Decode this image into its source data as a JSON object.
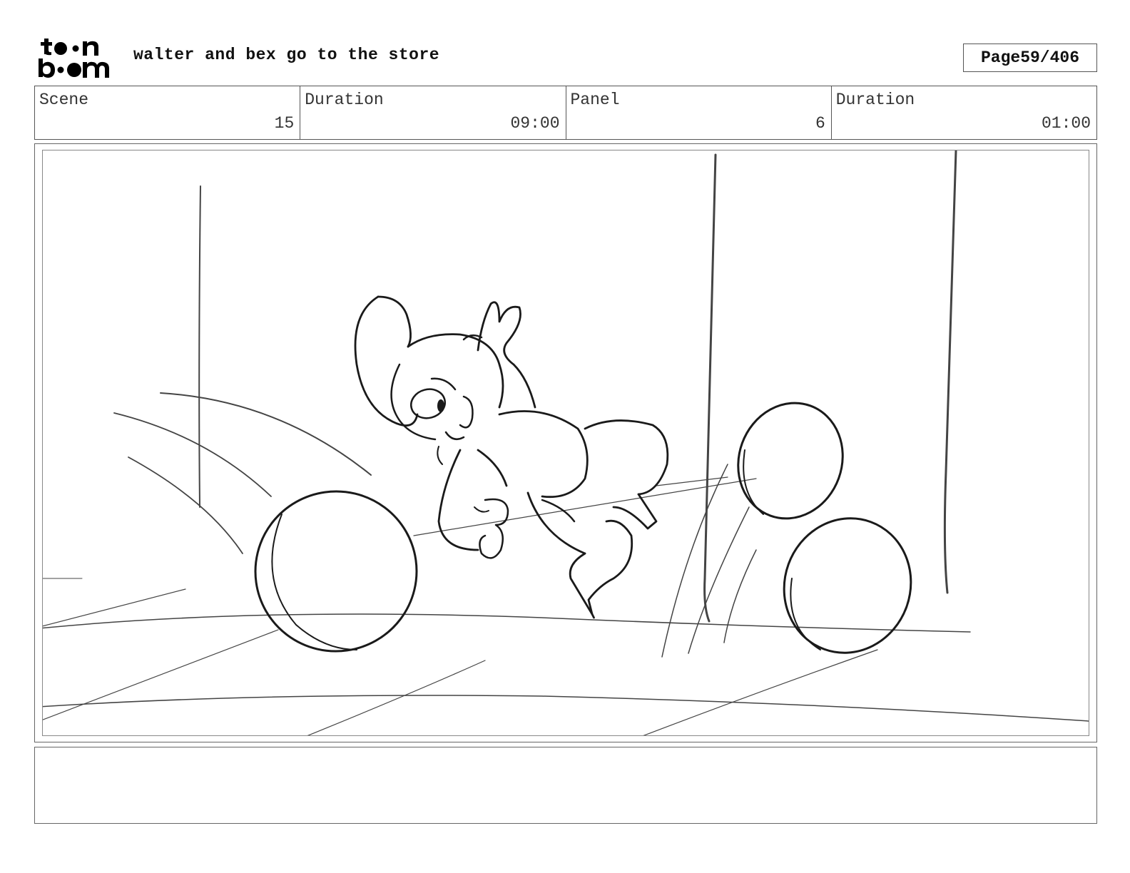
{
  "header": {
    "logo_text_top": "toon",
    "logo_text_bottom": "boom",
    "title": "walter and bex go to the store",
    "page_label": "Page",
    "page_number": "59/406"
  },
  "info": {
    "scene_label": "Scene",
    "scene_value": "15",
    "scene_duration_label": "Duration",
    "scene_duration_value": "09:00",
    "panel_label": "Panel",
    "panel_value": "6",
    "panel_duration_label": "Duration",
    "panel_duration_value": "01:00"
  },
  "notes": {
    "text": ""
  }
}
